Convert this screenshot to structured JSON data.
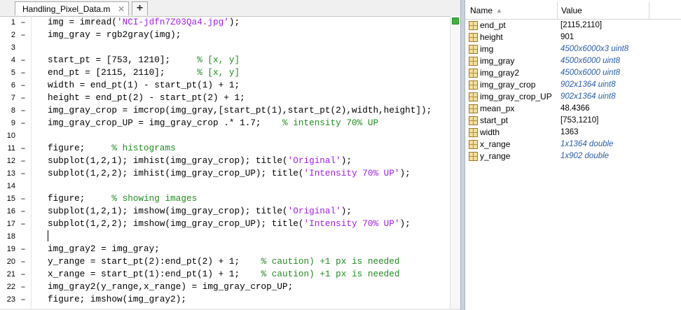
{
  "editor": {
    "tab_label": "Handling_Pixel_Data.m",
    "tab_close": "✕",
    "add_tab": "+",
    "lines": [
      {
        "n": "1",
        "dash": "–",
        "segs": [
          {
            "t": "img = imread(",
            "c": "plain"
          },
          {
            "t": "'NCI-jdfn7Z03Qa4.jpg'",
            "c": "str"
          },
          {
            "t": ");",
            "c": "plain"
          }
        ]
      },
      {
        "n": "2",
        "dash": "–",
        "segs": [
          {
            "t": "img_gray = rgb2gray(img);",
            "c": "plain"
          }
        ]
      },
      {
        "n": "3",
        "dash": "",
        "segs": []
      },
      {
        "n": "4",
        "dash": "–",
        "segs": [
          {
            "t": "start_pt = [753, 1210];     ",
            "c": "plain"
          },
          {
            "t": "% [x, y]",
            "c": "cmt"
          }
        ]
      },
      {
        "n": "5",
        "dash": "–",
        "segs": [
          {
            "t": "end_pt = [2115, 2110];      ",
            "c": "plain"
          },
          {
            "t": "% [x, y]",
            "c": "cmt"
          }
        ]
      },
      {
        "n": "6",
        "dash": "–",
        "segs": [
          {
            "t": "width = end_pt(1) - start_pt(1) + 1;",
            "c": "plain"
          }
        ]
      },
      {
        "n": "7",
        "dash": "–",
        "segs": [
          {
            "t": "height = end_pt(2) - start_pt(2) + 1;",
            "c": "plain"
          }
        ]
      },
      {
        "n": "8",
        "dash": "–",
        "segs": [
          {
            "t": "img_gray_crop = imcrop(img_gray,[start_pt(1),start_pt(2),width,height]);",
            "c": "plain"
          }
        ]
      },
      {
        "n": "9",
        "dash": "–",
        "segs": [
          {
            "t": "img_gray_crop_UP = img_gray_crop .* 1.7;    ",
            "c": "plain"
          },
          {
            "t": "% intensity 70% UP",
            "c": "cmt"
          }
        ]
      },
      {
        "n": "10",
        "dash": "",
        "segs": []
      },
      {
        "n": "11",
        "dash": "–",
        "segs": [
          {
            "t": "figure;     ",
            "c": "plain"
          },
          {
            "t": "% histograms",
            "c": "cmt"
          }
        ]
      },
      {
        "n": "12",
        "dash": "–",
        "segs": [
          {
            "t": "subplot(1,2,1); imhist(img_gray_crop); title(",
            "c": "plain"
          },
          {
            "t": "'Original'",
            "c": "str"
          },
          {
            "t": ");",
            "c": "plain"
          }
        ]
      },
      {
        "n": "13",
        "dash": "–",
        "segs": [
          {
            "t": "subplot(1,2,2); imhist(img_gray_crop_UP); title(",
            "c": "plain"
          },
          {
            "t": "'Intensity 70% UP'",
            "c": "str"
          },
          {
            "t": ");",
            "c": "plain"
          }
        ]
      },
      {
        "n": "14",
        "dash": "",
        "segs": []
      },
      {
        "n": "15",
        "dash": "–",
        "segs": [
          {
            "t": "figure;     ",
            "c": "plain"
          },
          {
            "t": "% showing images",
            "c": "cmt"
          }
        ]
      },
      {
        "n": "16",
        "dash": "–",
        "segs": [
          {
            "t": "subplot(1,2,1); imshow(img_gray_crop); title(",
            "c": "plain"
          },
          {
            "t": "'Original'",
            "c": "str"
          },
          {
            "t": ");",
            "c": "plain"
          }
        ]
      },
      {
        "n": "17",
        "dash": "–",
        "segs": [
          {
            "t": "subplot(1,2,2); imshow(img_gray_crop_UP); title(",
            "c": "plain"
          },
          {
            "t": "'Intensity 70% UP'",
            "c": "str"
          },
          {
            "t": ");",
            "c": "plain"
          }
        ]
      },
      {
        "n": "18",
        "dash": "",
        "segs": []
      },
      {
        "n": "19",
        "dash": "–",
        "segs": [
          {
            "t": "img_gray2 = img_gray;",
            "c": "plain"
          }
        ]
      },
      {
        "n": "20",
        "dash": "–",
        "segs": [
          {
            "t": "y_range = start_pt(2):end_pt(2) + 1;    ",
            "c": "plain"
          },
          {
            "t": "% caution) +1 px is needed",
            "c": "cmt"
          }
        ]
      },
      {
        "n": "21",
        "dash": "–",
        "segs": [
          {
            "t": "x_range = start_pt(1):end_pt(1) + 1;    ",
            "c": "plain"
          },
          {
            "t": "% caution) +1 px is needed",
            "c": "cmt"
          }
        ]
      },
      {
        "n": "22",
        "dash": "–",
        "segs": [
          {
            "t": "img_gray2(y_range,x_range) = img_gray_crop_UP;",
            "c": "plain"
          }
        ]
      },
      {
        "n": "23",
        "dash": "–",
        "segs": [
          {
            "t": "figure; imshow(img_gray2);",
            "c": "plain"
          }
        ]
      }
    ]
  },
  "workspace": {
    "col_name": "Name",
    "sort_arrow": "▲",
    "col_value": "Value",
    "variables": [
      {
        "name": "end_pt",
        "value": "[2115,2110]",
        "meta": false
      },
      {
        "name": "height",
        "value": "901",
        "meta": false
      },
      {
        "name": "img",
        "value": "4500x6000x3 uint8",
        "meta": true
      },
      {
        "name": "img_gray",
        "value": "4500x6000 uint8",
        "meta": true
      },
      {
        "name": "img_gray2",
        "value": "4500x6000 uint8",
        "meta": true
      },
      {
        "name": "img_gray_crop",
        "value": "902x1364 uint8",
        "meta": true
      },
      {
        "name": "img_gray_crop_UP",
        "value": "902x1364 uint8",
        "meta": true
      },
      {
        "name": "mean_px",
        "value": "48.4366",
        "meta": false
      },
      {
        "name": "start_pt",
        "value": "[753,1210]",
        "meta": false
      },
      {
        "name": "width",
        "value": "1363",
        "meta": false
      },
      {
        "name": "x_range",
        "value": "1x1364 double",
        "meta": true
      },
      {
        "name": "y_range",
        "value": "1x902 double",
        "meta": true
      }
    ]
  },
  "icons": {
    "variable": "variable-matrix-icon",
    "close": "close-icon",
    "add": "plus-icon",
    "sort": "sort-ascending-icon"
  },
  "colors": {
    "string": "#a020f0",
    "comment": "#228b22",
    "status_ok": "#3cb43c",
    "size_meta": "#2a5ea8"
  }
}
